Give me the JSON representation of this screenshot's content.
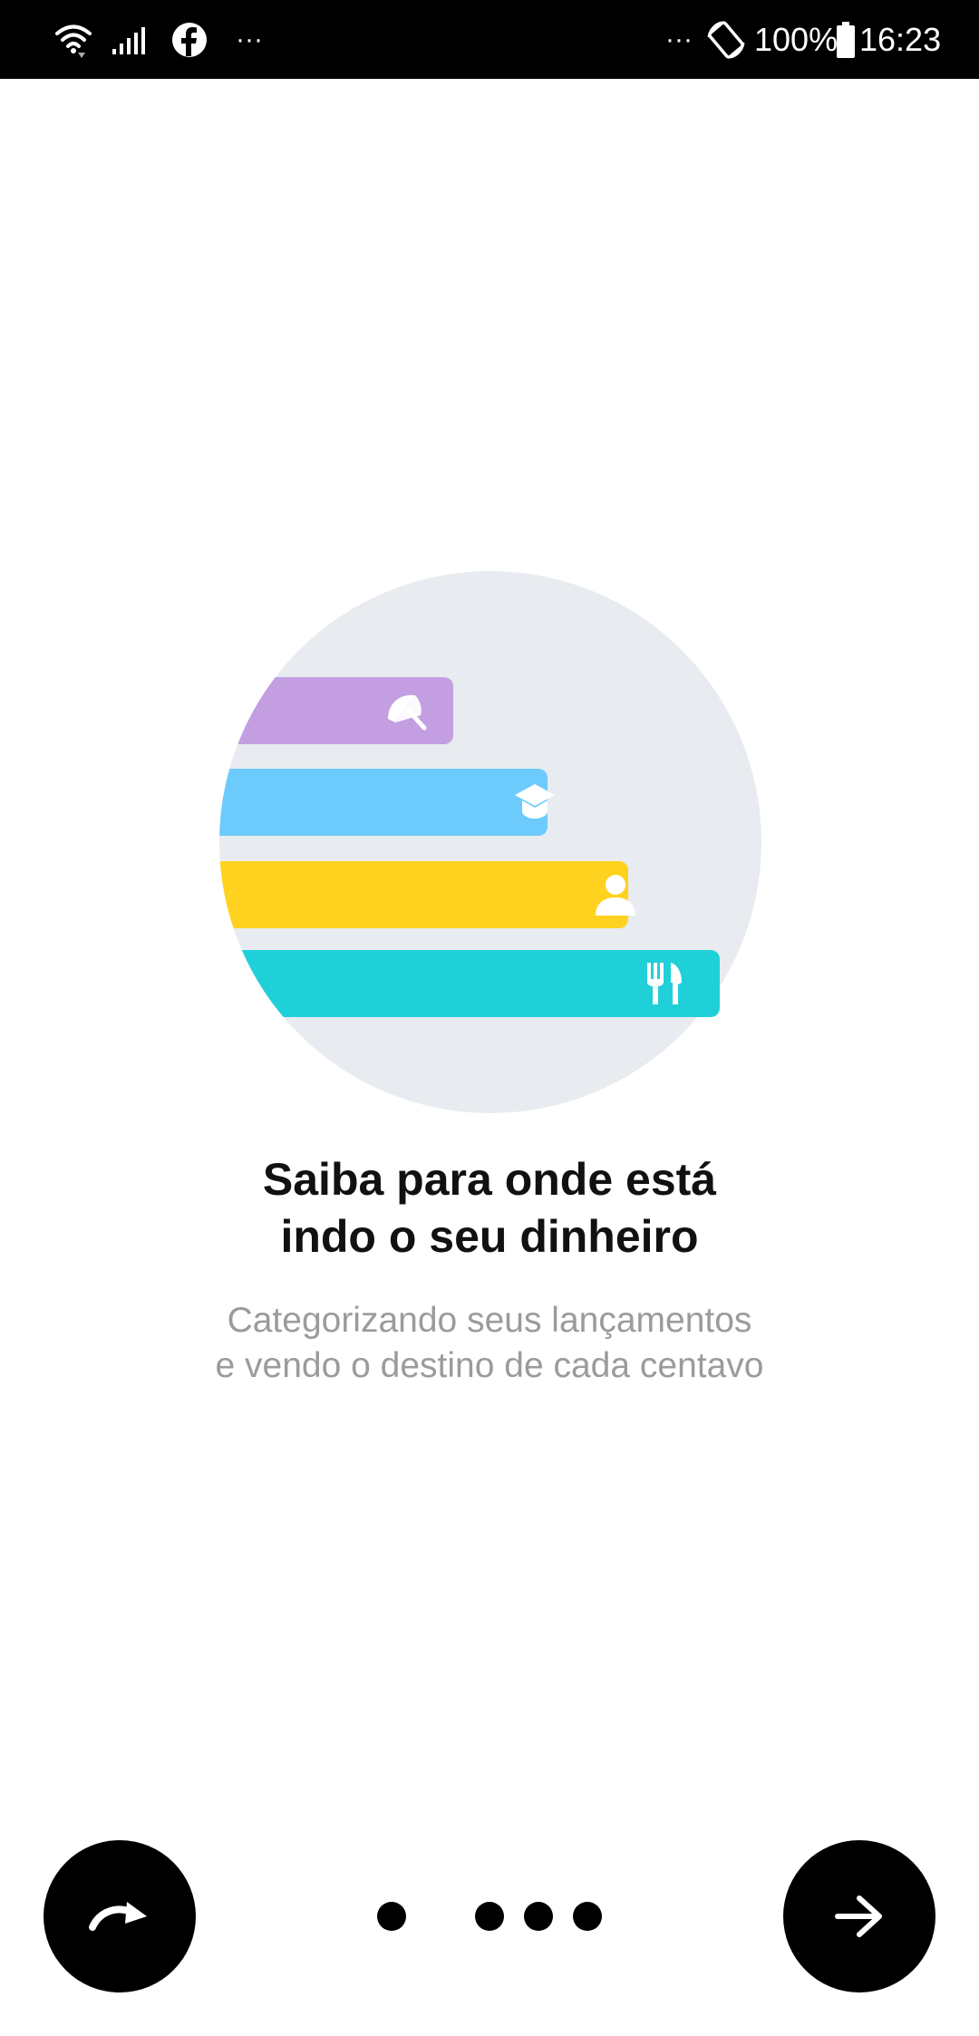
{
  "status_bar": {
    "left_more": "···",
    "right_more": "···",
    "battery_percent": "100%",
    "time": "16:23",
    "icons": [
      "wifi-icon",
      "signal-icon",
      "facebook-icon",
      "rotate-icon",
      "battery-icon"
    ]
  },
  "illustration": {
    "categories": [
      {
        "name": "vacation",
        "icon": "umbrella-icon",
        "color": "#c39fe2"
      },
      {
        "name": "education",
        "icon": "graduation-cap-icon",
        "color": "#6ccbfc"
      },
      {
        "name": "personal",
        "icon": "person-icon",
        "color": "#ffd21f"
      },
      {
        "name": "food",
        "icon": "fork-knife-icon",
        "color": "#20d0d8"
      }
    ],
    "background_color": "#e8ebef"
  },
  "content": {
    "title_line1": "Saiba para onde está",
    "title_line2": "indo o seu dinheiro",
    "subtitle_line1": "Categorizando seus lançamentos",
    "subtitle_line2": "e vendo o destino de cada centavo"
  },
  "controls": {
    "skip_icon": "redo-arrow-icon",
    "next_icon": "arrow-right-icon",
    "page_count": 4,
    "current_page": 1
  }
}
